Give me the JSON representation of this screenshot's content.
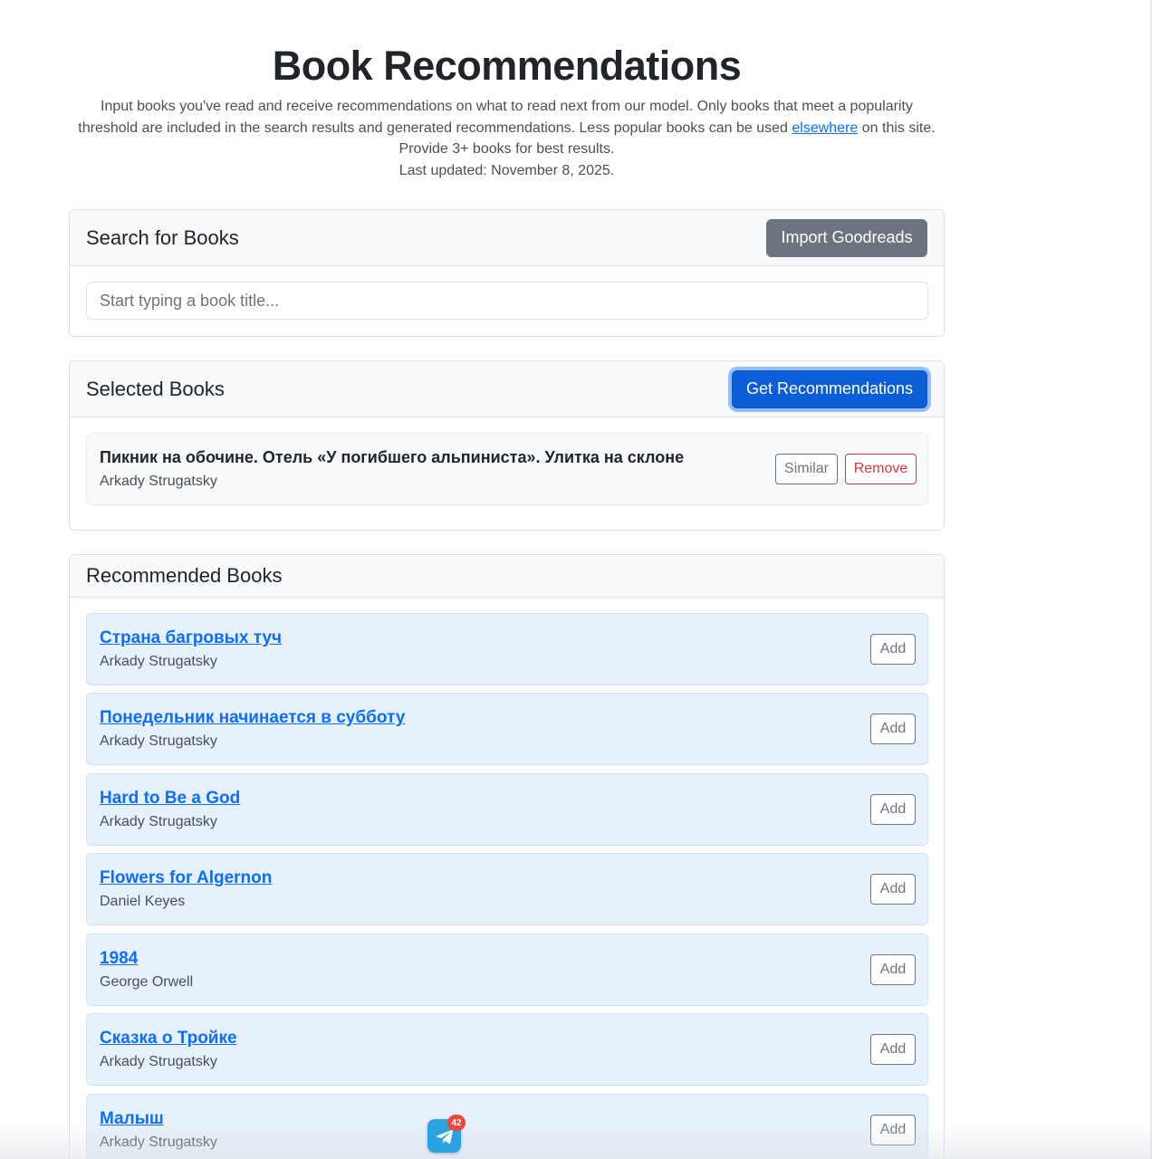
{
  "header": {
    "title": "Book Recommendations",
    "intro_text": "Input books you've read and receive recommendations on what to read next from our model. Only books that meet a popularity threshold are included in the search results and generated recommendations. Less popular books can be used",
    "intro_link": "elsewhere",
    "intro_after_link": "on this site. Provide 3+ books for best results.",
    "last_updated": "Last updated: November 8, 2025."
  },
  "search": {
    "title": "Search for Books",
    "import_label": "Import Goodreads",
    "placeholder": "Start typing a book title..."
  },
  "selected": {
    "title": "Selected Books",
    "get_label": "Get Recommendations",
    "items": [
      {
        "title": "Пикник на обочине. Отель «У погибшего альпиниста». Улитка на склоне",
        "author": "Arkady Strugatsky",
        "similar_label": "Similar",
        "remove_label": "Remove"
      }
    ]
  },
  "recommended": {
    "title": "Recommended Books",
    "add_label": "Add",
    "items": [
      {
        "title": "Страна багровых туч",
        "author": "Arkady Strugatsky"
      },
      {
        "title": "Понедельник начинается в субботу",
        "author": "Arkady Strugatsky"
      },
      {
        "title": "Hard to Be a God",
        "author": "Arkady Strugatsky"
      },
      {
        "title": "Flowers for Algernon",
        "author": "Daniel Keyes"
      },
      {
        "title": "1984",
        "author": "George Orwell"
      },
      {
        "title": "Сказка о Тройке",
        "author": "Arkady Strugatsky"
      },
      {
        "title": "Малыш",
        "author": "Arkady Strugatsky"
      }
    ]
  },
  "widget": {
    "icon": "telegram-icon",
    "badge": "42"
  },
  "colors": {
    "primary": "#0b5ed7",
    "secondary": "#6c757d",
    "danger": "#dc3545",
    "link": "#0d6efd",
    "rec_bg": "#e7f1fb",
    "telegram": "#2aa3e0"
  }
}
